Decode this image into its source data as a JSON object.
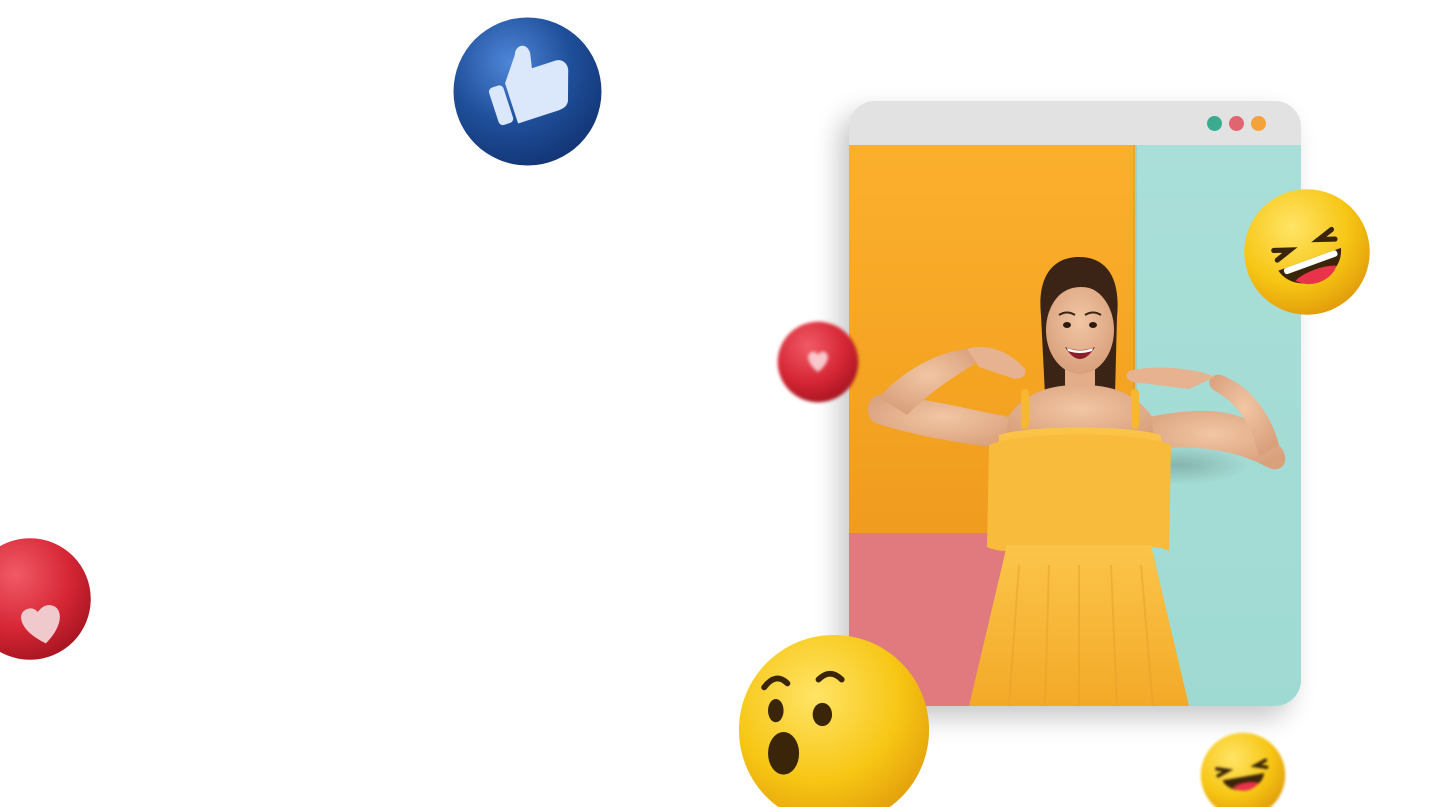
{
  "browser_window": {
    "dots": [
      {
        "name": "green",
        "color": "#3bab8f"
      },
      {
        "name": "red",
        "color": "#e0656e"
      },
      {
        "name": "orange",
        "color": "#f4a23a"
      }
    ],
    "titlebar_color": "#e2e2e2"
  },
  "photo": {
    "subject": "woman-pointing-at-smile",
    "wall_colors": {
      "orange": "#f8a928",
      "pink": "#e07a7f",
      "teal": "#a4dcd5"
    },
    "dress_color": "#f7b731"
  },
  "reactions": [
    {
      "icon": "thumbs-up-icon",
      "color": "#1f4f9a"
    },
    {
      "icon": "heart-icon",
      "color": "#d62635"
    },
    {
      "icon": "heart-icon",
      "color": "#d62635"
    },
    {
      "icon": "laughing-face-icon",
      "color": "#f7c614"
    },
    {
      "icon": "surprised-face-icon",
      "color": "#f7c614"
    },
    {
      "icon": "laughing-face-icon",
      "color": "#f7c614"
    }
  ]
}
